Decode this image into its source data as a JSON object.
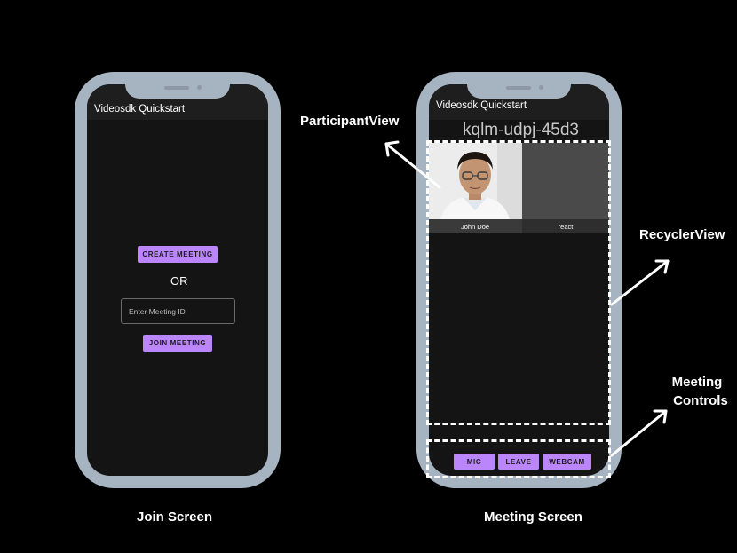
{
  "join_screen": {
    "app_title": "Videosdk Quickstart",
    "create_button": "CREATE MEETING",
    "or_text": "OR",
    "meeting_id_placeholder": "Enter Meeting ID",
    "join_button": "JOIN MEETING",
    "caption": "Join Screen"
  },
  "meeting_screen": {
    "app_title": "Videosdk Quickstart",
    "meeting_id": "kqlm-udpj-45d3",
    "participants": [
      {
        "name": "John Doe"
      },
      {
        "name": "react"
      }
    ],
    "controls": {
      "mic": "MIC",
      "leave": "LEAVE",
      "webcam": "WEBCAM"
    },
    "caption": "Meeting Screen"
  },
  "annotations": {
    "participant_view": "ParticipantView",
    "recycler_view": "RecyclerView",
    "meeting_controls_line1": "Meeting",
    "meeting_controls_line2": "Controls"
  },
  "colors": {
    "background": "#000000",
    "phone_frame": "#a6b3c0",
    "screen": "#141414",
    "accent_button": "#bb86fc"
  }
}
